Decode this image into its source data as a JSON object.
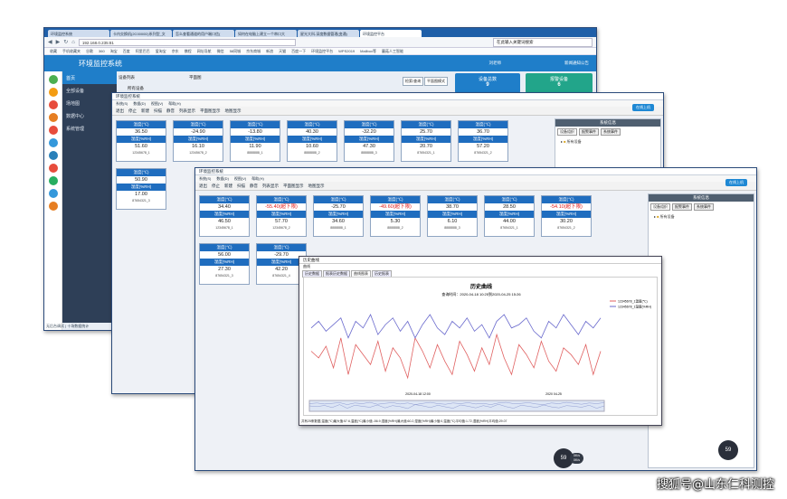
{
  "browser": {
    "tabs": [
      "环境监控系统",
      "卡内交换机(2C0000D)系列型_文",
      "怎么查看通道的用户端口信(",
      "如何在电脑上建立一个串口大",
      "星光大科-深度数据管理(变通)",
      "环境监控平台"
    ],
    "address": "192.168.0.235:81",
    "search_placeholder": "在此输入关键词搜索",
    "bookmarks": [
      "收藏",
      "手机收藏夹",
      "谷歌",
      "360",
      "淘宝",
      "百度",
      "阿里巴巴",
      "爱淘宝",
      "京东",
      "携程",
      "网址导航",
      "微信",
      "58同城",
      "京东商城",
      "新浪",
      "天猫",
      "百度一下",
      "环境监控平台",
      "WPS2019",
      "Mailbox等",
      "蘑菇人工智能"
    ],
    "status": "无后台调试 | 十场数据统计"
  },
  "app": {
    "title": "环境监控系统",
    "user": "刘老师",
    "notice": "新闻通知公告",
    "nav": [
      "首页",
      "全部设备",
      "场地图",
      "数据中心",
      "系统管理"
    ],
    "tabs": [
      "设备列表",
      "平面图"
    ],
    "tree_root": "所有设备",
    "search_btn": "检索/查询",
    "view_btn": "平面图模式",
    "stat1_label": "设备总数",
    "stat1_value": "9",
    "stat2_label": "报警设备",
    "stat2_value": "6"
  },
  "client": {
    "title": "环境监控系统",
    "menus": [
      "系统(S)",
      "数据(D)",
      "视图(V)",
      "帮助(H)"
    ],
    "tools": [
      "退出",
      "停止",
      "新建",
      "扫描",
      "静音",
      "列表显示",
      "平面图显示",
      "地图显示"
    ],
    "online_btn": "在线上机",
    "side_title": "系统信息",
    "side_tabs": [
      "设备组织",
      "报警事件",
      "系统事件"
    ],
    "temp_label": "温度(℃)",
    "hum_label": "湿度(%RH)"
  },
  "cards_back": [
    {
      "t": "36.50",
      "h": "51.60",
      "id": "12345678_1"
    },
    {
      "t": "-24.90",
      "h": "16.10",
      "id": "12345678_2"
    },
    {
      "t": "-13.80",
      "h": "11.90",
      "id": "8888888_1"
    },
    {
      "t": "40.30",
      "h": "10.60",
      "id": "8888888_2"
    },
    {
      "t": "-32.20",
      "h": "47.30",
      "id": "8888888_3"
    },
    {
      "t": "25.70",
      "h": "20.70",
      "id": "87654321_1"
    },
    {
      "t": "36.70",
      "h": "57.20",
      "id": "87654321_2"
    },
    {
      "t": "50.90",
      "h": "17.00",
      "id": "87654321_3"
    }
  ],
  "cards_front": [
    {
      "t": "34.40",
      "h": "46.50",
      "id": "12345678_1",
      "alarm": false
    },
    {
      "t": "-55.40(超下限)",
      "h": "57.70",
      "id": "12345678_2",
      "alarm": true
    },
    {
      "t": "-25.70",
      "h": "34.60",
      "id": "8888888_1",
      "alarm": false
    },
    {
      "t": "-49.60(超下限)",
      "h": "5.30",
      "id": "8888888_2",
      "alarm": true
    },
    {
      "t": "38.70",
      "h": "6.10",
      "id": "8888888_3",
      "alarm": false
    },
    {
      "t": "28.50",
      "h": "44.00",
      "id": "87654321_1",
      "alarm": false
    },
    {
      "t": "-54.10(超下限)",
      "h": "30.20",
      "id": "87654321_2",
      "alarm": true
    },
    {
      "t": "56.00",
      "h": "27.30",
      "id": "87654321_3",
      "alarm": false
    },
    {
      "t": "-29.70",
      "h": "42.20",
      "id": "87654321_4",
      "alarm": false
    }
  ],
  "history": {
    "title": "历史曲线",
    "menu": "曲线",
    "tabs": [
      "历史数据",
      "报表历史数据",
      "曲线图表",
      "历史报表"
    ],
    "chart_title": "历史曲线",
    "query_time": "查询时间：2020-04-18 10:25到2020-04-25 15:26",
    "legend": [
      "12345678_1温度(℃)",
      "12345678_1湿度(%RH)"
    ],
    "x_ticks": [
      "2020-04-18\n12:00",
      "2020\n04-25"
    ],
    "status": "共有25条数据,温度(℃)最大值:57.6,温度(℃)最小值:-56.9,湿度(%RH)最大值:60.2,湿度(%RH)最小值:0,温度(℃)平均值:1.72,湿度(%RH)平均值:29.07"
  },
  "gauge1": {
    "value": "59",
    "unit": "%",
    "up": "0K/s",
    "down": "0K/s"
  },
  "gauge2": {
    "value": "59",
    "unit": "%"
  },
  "watermark": "搜狐号@山东仁科测控",
  "chart_data": {
    "type": "line",
    "title": "历史曲线",
    "series": [
      {
        "name": "12345678_1温度(℃)",
        "color": "#e06060",
        "values": [
          22,
          18,
          25,
          12,
          30,
          8,
          26,
          20,
          14,
          28,
          10,
          24,
          18,
          6,
          30,
          22,
          12,
          26,
          16,
          8,
          28,
          20,
          10,
          24,
          14,
          32,
          18,
          8,
          26,
          20,
          12,
          28,
          16,
          10,
          24,
          20,
          14,
          26,
          8,
          22
        ]
      },
      {
        "name": "12345678_1湿度(%RH)",
        "color": "#6a6acd",
        "values": [
          36,
          40,
          34,
          38,
          42,
          30,
          40,
          36,
          44,
          32,
          38,
          42,
          34,
          40,
          30,
          38,
          44,
          36,
          32,
          40,
          36,
          42,
          34,
          38,
          30,
          40,
          44,
          36,
          38,
          42,
          34,
          30,
          40,
          36,
          44,
          38,
          32,
          40,
          36,
          42
        ]
      }
    ]
  }
}
